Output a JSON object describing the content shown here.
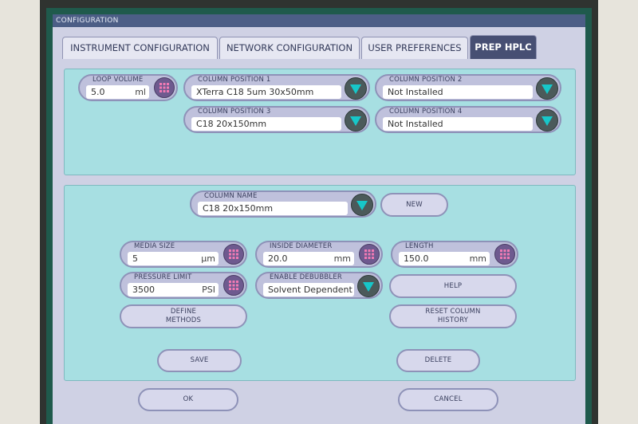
{
  "window": {
    "title": "CONFIGURATION"
  },
  "tabs": [
    {
      "label": "INSTRUMENT CONFIGURATION"
    },
    {
      "label": "NETWORK CONFIGURATION"
    },
    {
      "label": "USER PREFERENCES"
    },
    {
      "label": "PREP HPLC",
      "active": true
    }
  ],
  "top_panel": {
    "loop_volume": {
      "label": "LOOP VOLUME",
      "value": "5.0",
      "unit": "ml",
      "icon": "keypad-icon"
    },
    "column_position_1": {
      "label": "COLUMN POSITION 1",
      "value": "XTerra C18 5um 30x50mm",
      "icon": "dropdown-arrow-icon"
    },
    "column_position_2": {
      "label": "COLUMN POSITION 2",
      "value": "Not Installed",
      "icon": "dropdown-arrow-icon"
    },
    "column_position_3": {
      "label": "COLUMN POSITION 3",
      "value": "C18 20x150mm",
      "icon": "dropdown-arrow-icon"
    },
    "column_position_4": {
      "label": "COLUMN POSITION 4",
      "value": "Not Installed",
      "icon": "dropdown-arrow-icon"
    }
  },
  "column_panel": {
    "column_name": {
      "label": "COLUMN NAME",
      "value": "C18 20x150mm"
    },
    "new_button": "NEW",
    "media_size": {
      "label": "MEDIA SIZE",
      "value": "5",
      "unit": "µm"
    },
    "inside_diameter": {
      "label": "INSIDE DIAMETER",
      "value": "20.0",
      "unit": "mm"
    },
    "length": {
      "label": "LENGTH",
      "value": "150.0",
      "unit": "mm"
    },
    "pressure_limit": {
      "label": "PRESSURE LIMIT",
      "value": "3500",
      "unit": "PSI"
    },
    "enable_debubbler": {
      "label": "ENABLE DEBUBBLER",
      "value": "Solvent Dependent"
    },
    "help_button": "HELP",
    "define_methods_button": "DEFINE\nMETHODS",
    "reset_history_button": "RESET COLUMN\nHISTORY",
    "save_button": "SAVE",
    "delete_button": "DELETE"
  },
  "footer": {
    "ok_button": "OK",
    "cancel_button": "CANCEL"
  },
  "colors": {
    "screen_bg": "#1f5a4c",
    "dialog_bg": "#cfd1e4",
    "panel_bg": "#a7dfe2",
    "active_tab": "#474f73",
    "keypad_button": "#6e5a8f",
    "dropdown_button": "#4b5a5a"
  }
}
